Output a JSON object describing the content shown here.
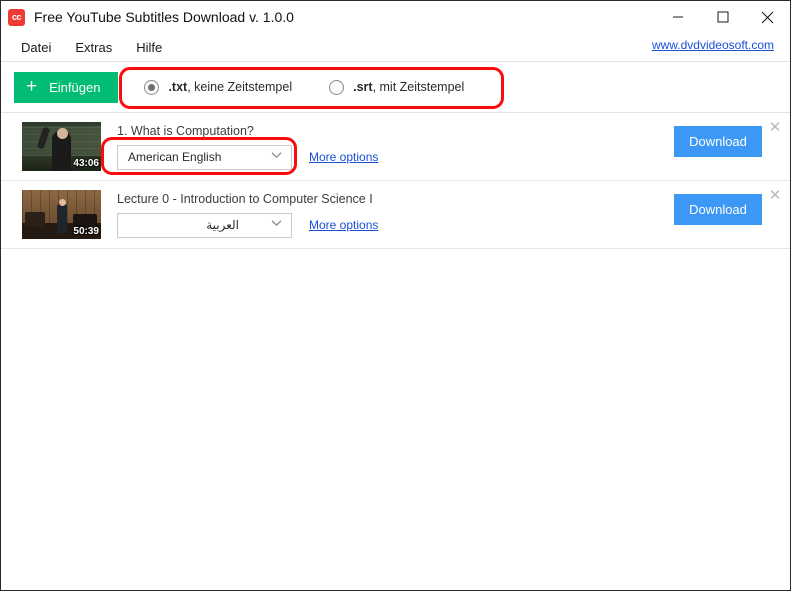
{
  "window": {
    "title": "Free YouTube Subtitles Download v. 1.0.0",
    "app_icon": "cc-icon",
    "icon_label": "cc",
    "controls": {
      "minimize": "minimize-icon",
      "maximize": "maximize-icon",
      "close": "close-icon"
    },
    "border_color": "#2b2b2b"
  },
  "menu": {
    "items": [
      {
        "label": "Datei"
      },
      {
        "label": "Extras"
      },
      {
        "label": "Hilfe"
      }
    ],
    "site_link": "www.dvdvideosoft.com"
  },
  "toolbar": {
    "insert_label": "Einfügen",
    "insert_icon": "plus-icon",
    "insert_color": "#00bd73",
    "format_options": [
      {
        "bold": ".txt",
        "rest": ", keine Zeitstempel",
        "selected": true
      },
      {
        "bold": ".srt",
        "rest": ", mit Zeitstempel",
        "selected": false
      }
    ]
  },
  "list": {
    "rows": [
      {
        "title": "1. What is Computation?",
        "duration": "43:06",
        "language": "American English",
        "more_options": "More options",
        "download_label": "Download",
        "remove_icon": "close-icon",
        "chevron_icon": "chevron-down-icon"
      },
      {
        "title": "Lecture 0 - Introduction to Computer Science I",
        "duration": "50:39",
        "language": "العربية",
        "more_options": "More options",
        "download_label": "Download",
        "remove_icon": "close-icon",
        "chevron_icon": "chevron-down-icon"
      }
    ]
  },
  "annotations": {
    "color": "#f70d0d",
    "shapes": [
      {
        "name": "format-options-highlight"
      },
      {
        "name": "language-select-highlight"
      }
    ]
  },
  "colors": {
    "accent_green": "#00bd73",
    "accent_blue": "#3d97f5",
    "link_blue": "#1a4fd6",
    "annotation_red": "#f70d0d"
  }
}
